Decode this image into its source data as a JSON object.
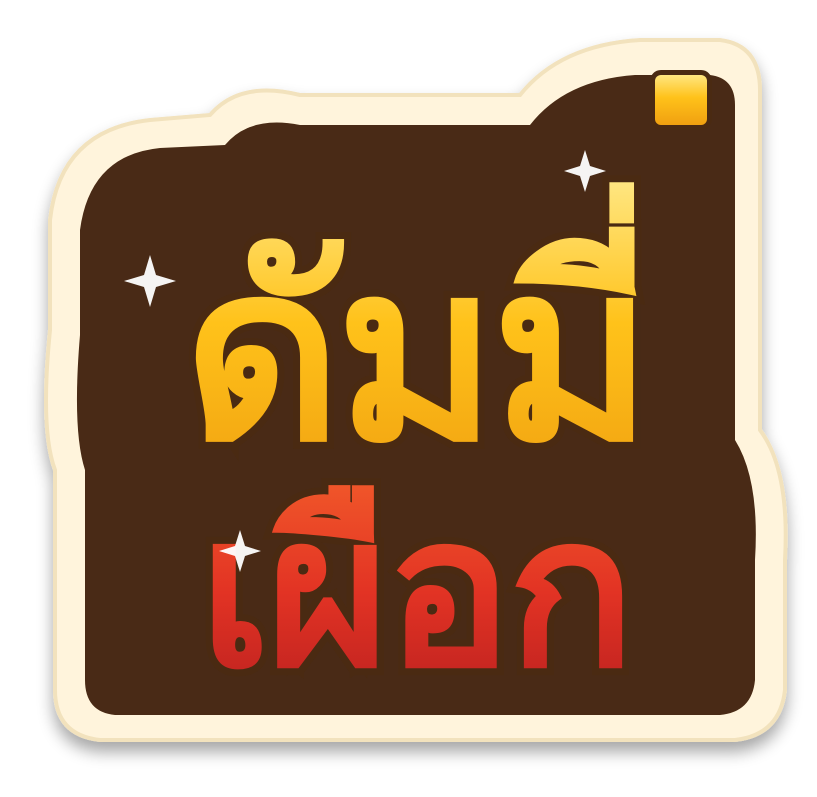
{
  "logo": {
    "line1": "ดัมมี่",
    "line2": "เผือก",
    "colors": {
      "sticker_bg": "#fff4dc",
      "outline": "#4a2a12",
      "line1_top": "#ffe680",
      "line1_bottom": "#f0a010",
      "line2_top": "#f25a2a",
      "line2_bottom": "#b81f1f",
      "sparkle": "#ffffff"
    }
  }
}
